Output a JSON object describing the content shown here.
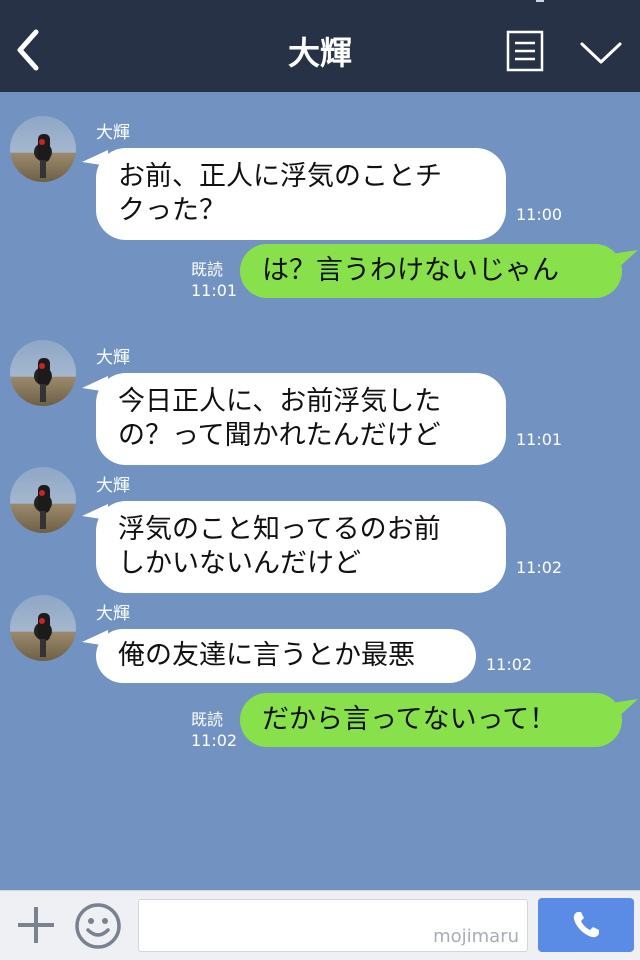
{
  "header": {
    "title": "大輝",
    "back_icon": "chevron-left-icon",
    "menu_icon": "notes-icon",
    "expand_icon": "chevron-down-icon"
  },
  "messages": [
    {
      "sender": "大輝",
      "lines": [
        "お前、正人に浮気のことチ",
        "クった？"
      ],
      "time": "11:00"
    },
    {
      "text": "は？言うわけないじゃん",
      "read": "既読",
      "time": "11:01"
    },
    {
      "sender": "大輝",
      "lines": [
        "今日正人に、お前浮気した",
        "の？って聞かれたんだけど"
      ],
      "time": "11:01"
    },
    {
      "sender": "大輝",
      "lines": [
        "浮気のこと知ってるのお前",
        "しかいないんだけど"
      ],
      "time": "11:02"
    },
    {
      "sender": "大輝",
      "lines": [
        "俺の友達に言うとか最悪"
      ],
      "time": "11:02"
    },
    {
      "text": "だから言ってないって！",
      "read": "既読",
      "time": "11:02"
    }
  ],
  "footer": {
    "plus_icon": "plus-icon",
    "emoji_icon": "smiley-icon",
    "input_value": "",
    "watermark": "mojimaru",
    "call_icon": "phone-icon"
  },
  "colors": {
    "header_bg": "#273246",
    "chat_bg": "#7293c1",
    "incoming_bubble": "#ffffff",
    "outgoing_bubble": "#88e04b",
    "call_button": "#5a8ce6"
  }
}
